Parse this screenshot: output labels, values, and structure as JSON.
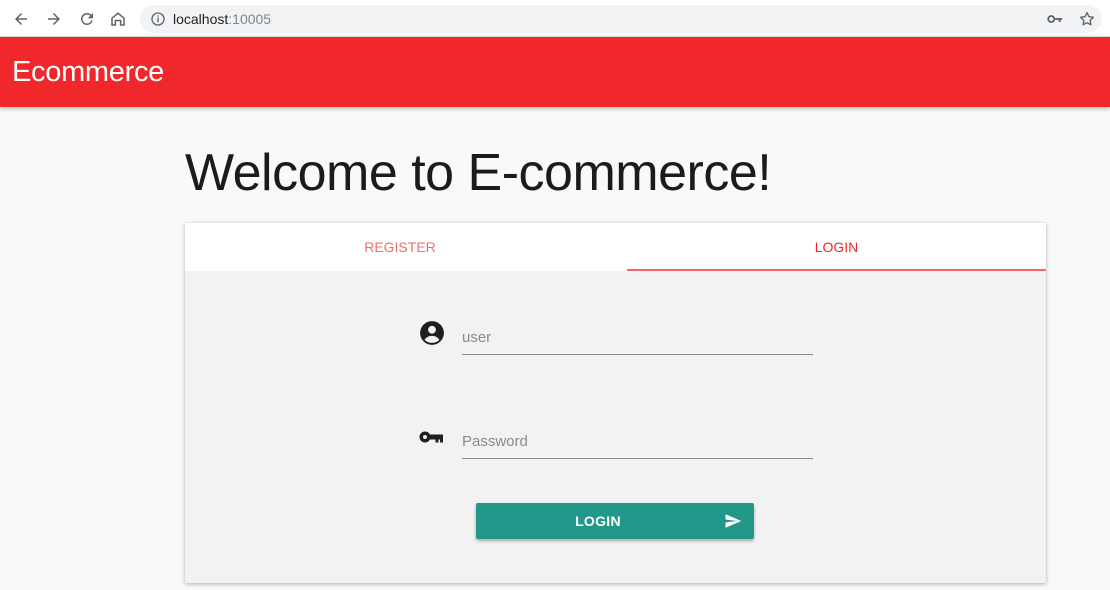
{
  "browser": {
    "url_host": "localhost",
    "url_port": ":10005"
  },
  "app_bar": {
    "title": "Ecommerce",
    "color": "#f0282c"
  },
  "page": {
    "heading": "Welcome to E-commerce!"
  },
  "tabs": [
    {
      "label": "REGISTER",
      "active": false
    },
    {
      "label": "LOGIN",
      "active": true
    }
  ],
  "form": {
    "user_placeholder": "user",
    "password_placeholder": "Password",
    "user_value": "",
    "password_value": "",
    "submit_label": "LOGIN",
    "submit_color": "#21988a"
  },
  "icons": {
    "user_field": "account-circle-icon",
    "password_field": "key-icon",
    "submit": "send-icon"
  }
}
